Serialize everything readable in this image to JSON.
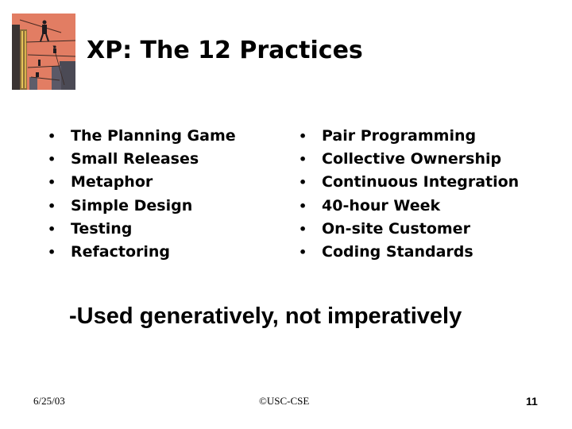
{
  "slide": {
    "title": "XP: The 12 Practices",
    "image": "tightrope-walkers-illustration",
    "left_items": [
      "The Planning Game",
      "Small Releases",
      "Metaphor",
      "Simple Design",
      "Testing",
      "Refactoring"
    ],
    "right_items": [
      "Pair Programming",
      "Collective Ownership",
      "Continuous Integration",
      "40-hour Week",
      "On-site Customer",
      "Coding Standards"
    ],
    "bullet_glyph": "•",
    "tagline": "-Used generatively, not imperatively",
    "footer": {
      "date": "6/25/03",
      "copyright": "©USC-CSE",
      "page_number": "11"
    }
  }
}
